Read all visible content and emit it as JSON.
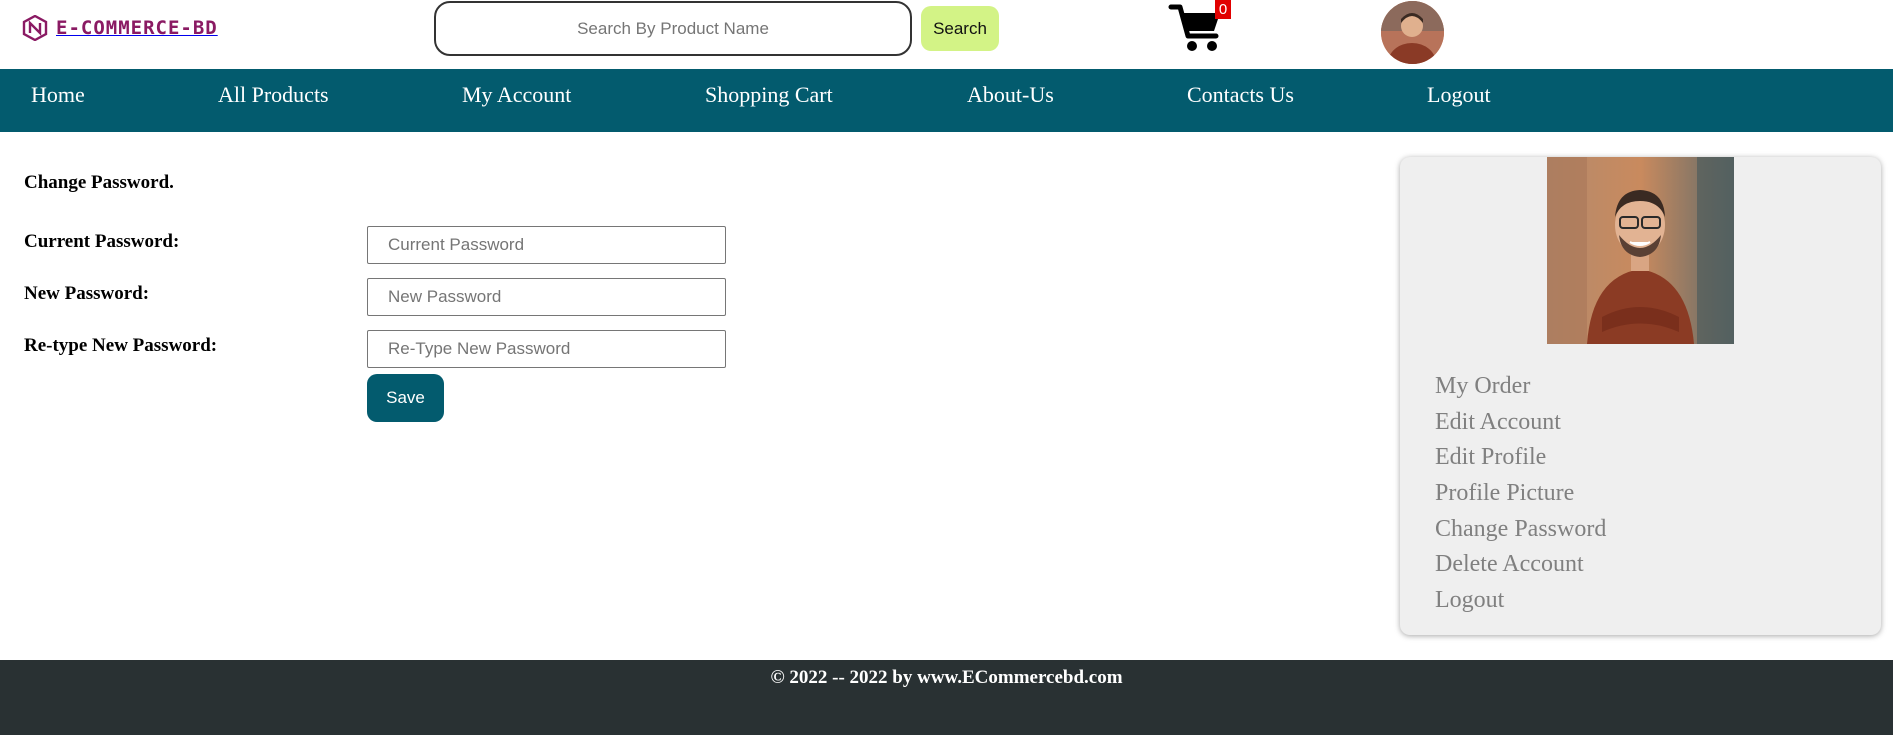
{
  "brand": {
    "name": "E-COMMERCE-BD",
    "logo_icon": "brand-logo-icon",
    "color": "#8a1a63"
  },
  "search": {
    "placeholder": "Search By Product Name",
    "value": "",
    "button_label": "Search"
  },
  "cart": {
    "icon": "shopping-cart-icon",
    "count": "0"
  },
  "user": {
    "avatar": "user-avatar"
  },
  "nav": {
    "items": [
      {
        "label": "Home"
      },
      {
        "label": "All Products"
      },
      {
        "label": "My Account"
      },
      {
        "label": "Shopping Cart"
      },
      {
        "label": "About-Us"
      },
      {
        "label": "Contacts Us"
      },
      {
        "label": "Logout"
      }
    ]
  },
  "form": {
    "title": "Change Password.",
    "fields": [
      {
        "label": "Current Password:",
        "placeholder": "Current Password",
        "value": ""
      },
      {
        "label": "New Password:",
        "placeholder": "New Password",
        "value": ""
      },
      {
        "label": "Re-type New Password:",
        "placeholder": "Re-Type New Password",
        "value": ""
      }
    ],
    "save_label": "Save"
  },
  "sidebar": {
    "items": [
      {
        "label": "My Order"
      },
      {
        "label": "Edit Account"
      },
      {
        "label": "Edit Profile"
      },
      {
        "label": "Profile Picture"
      },
      {
        "label": "Change Password"
      },
      {
        "label": "Delete Account"
      },
      {
        "label": "Logout"
      }
    ]
  },
  "footer": {
    "text": "© 2022 -- 2022 by www.ECommercebd.com"
  },
  "colors": {
    "nav_bg": "#035b6e",
    "search_button": "#d3f386",
    "footer_bg": "#293133",
    "badge": "#e10000",
    "sidebar_link": "#808080"
  }
}
